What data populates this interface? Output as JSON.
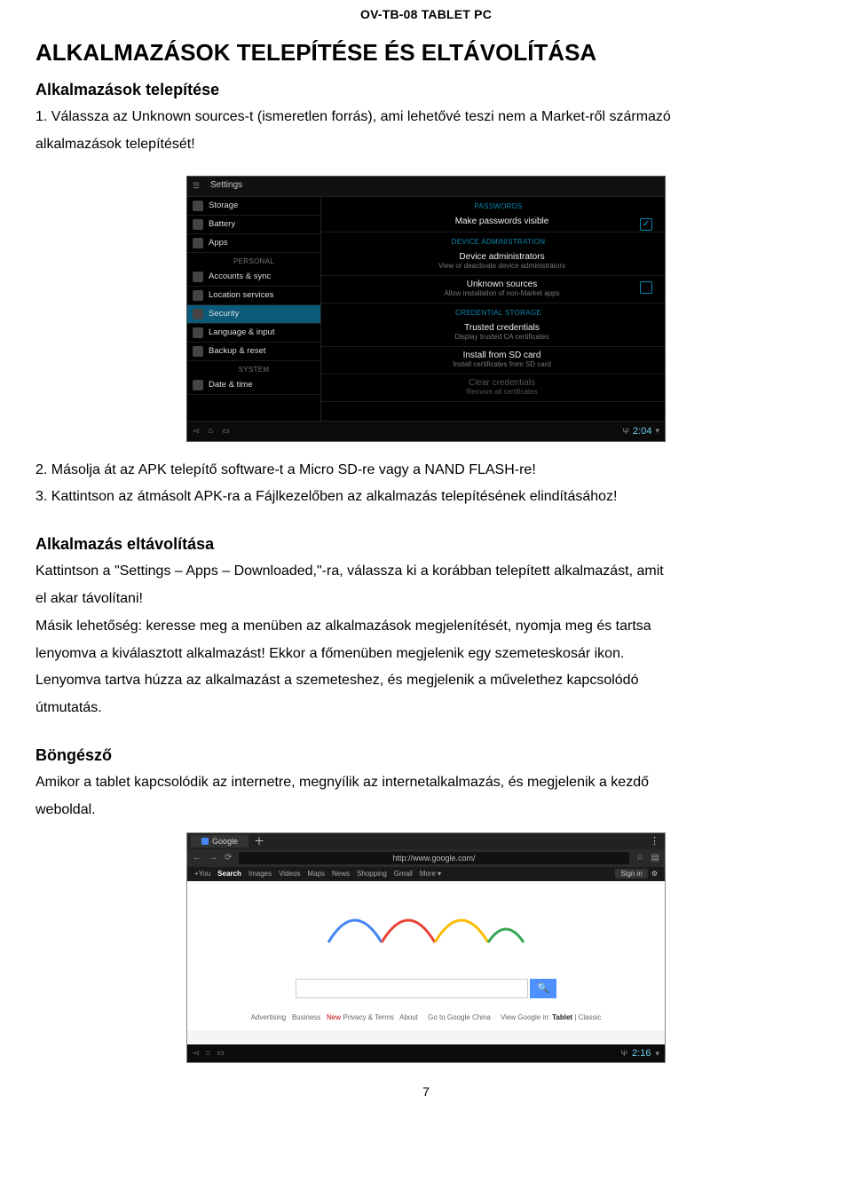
{
  "header": {
    "title": "OV-TB-08 TABLET PC"
  },
  "section1": {
    "heading": "ALKALMAZÁSOK TELEPÍTÉSE ÉS ELTÁVOLÍTÁSA",
    "sub": "Alkalmazások telepítése",
    "p1": "1. Válassza az Unknown sources-t (ismeretlen forrás), ami lehetővé teszi nem a Market-ről származó",
    "p1b": "alkalmazások telepítését!",
    "p2": "2. Másolja át az APK telepítő software-t a Micro SD-re vagy a NAND FLASH-re!",
    "p3": "3. Kattintson az átmásolt APK-ra a Fájlkezelőben az alkalmazás telepítésének elindításához!"
  },
  "section2": {
    "heading": "Alkalmazás eltávolítása",
    "p1": "Kattintson a \"Settings – Apps – Downloaded,\"-ra, válassza ki a korábban telepített alkalmazást, amit",
    "p1b": "el akar távolítani!",
    "p2": "Másik lehetőség: keresse meg a menüben az alkalmazások megjelenítését, nyomja meg és tartsa",
    "p2b": "lenyomva a kiválasztott alkalmazást! Ekkor a főmenüben megjelenik egy szemeteskosár ikon.",
    "p3": "Lenyomva tartva húzza az alkalmazást a szemeteshez, és megjelenik a művelethez kapcsolódó",
    "p3b": "útmutatás."
  },
  "section3": {
    "heading": "Böngésző",
    "p1": "Amikor a tablet kapcsolódik az internetre, megnyílik az internetalkalmazás, és megjelenik a kezdő",
    "p1b": "weboldal."
  },
  "shot_settings": {
    "title": "Settings",
    "side": {
      "items_top": [
        "Storage",
        "Battery",
        "Apps"
      ],
      "cat1": "PERSONAL",
      "items_mid": [
        "Accounts & sync",
        "Location services",
        "Security",
        "Language & input",
        "Backup & reset"
      ],
      "cat2": "SYSTEM",
      "items_bot": [
        "Date & time"
      ]
    },
    "main": {
      "cat_pw": "PASSWORDS",
      "item_pw": {
        "title": "Make passwords visible"
      },
      "cat_da": "DEVICE ADMINISTRATION",
      "item_adm": {
        "title": "Device administrators",
        "desc": "View or deactivate device administrators"
      },
      "item_unk": {
        "title": "Unknown sources",
        "desc": "Allow installation of non-Market apps"
      },
      "cat_cs": "CREDENTIAL STORAGE",
      "item_trust": {
        "title": "Trusted credentials",
        "desc": "Display trusted CA certificates"
      },
      "item_sd": {
        "title": "Install from SD card",
        "desc": "Install certificates from SD card"
      },
      "item_clear": {
        "title": "Clear credentials",
        "desc": "Remove all certificates"
      }
    },
    "nav": {
      "clock": "2:04"
    }
  },
  "shot_browser": {
    "tab": "Google",
    "url": "http://www.google.com/",
    "ribbon": {
      "you": "+You",
      "items": [
        "Search",
        "Images",
        "Videos",
        "Maps",
        "News",
        "Shopping",
        "Gmail",
        "More ▾"
      ],
      "signin": "Sign in"
    },
    "footer": {
      "t1": "Advertising",
      "t2": "Business",
      "t3": "New",
      "t4": "Privacy & Terms",
      "t5": "About",
      "t6": "Go to Google China",
      "t7": "View Google in:",
      "t8": "Tablet",
      "t9": "| Classic"
    },
    "nav": {
      "clock": "2:16"
    }
  },
  "page_number": "7"
}
